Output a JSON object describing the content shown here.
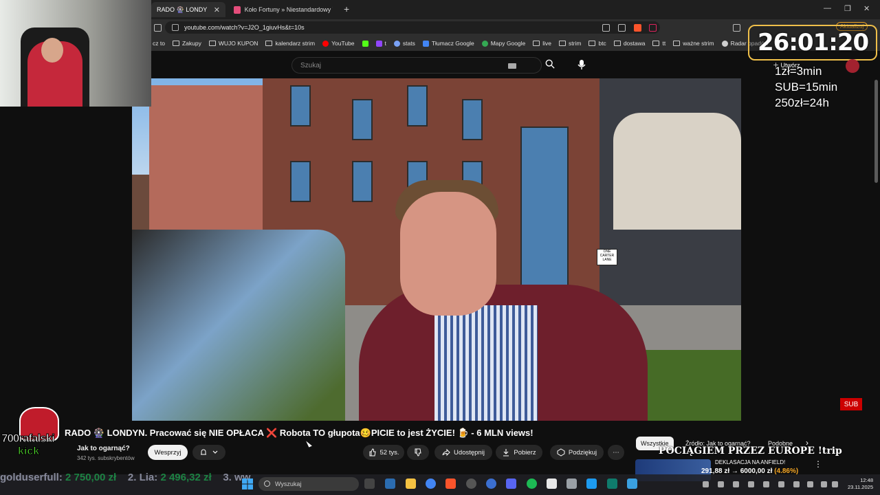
{
  "browser": {
    "tabs": [
      {
        "label": "RADO 🎡 LONDYN. Pracować",
        "active": true
      },
      {
        "label": "Koło Fortuny » Niestandardowy Wyb",
        "active": false
      }
    ],
    "url": "youtube.com/watch?v=J2O_1giuvHs&t=10s",
    "update_label": "Aktualizuj",
    "bookmarks": [
      "cz to",
      "Zakupy",
      "WUJO KUPON",
      "kalendarz strim",
      "YouTube",
      "t",
      "stats",
      "Tłumacz Google",
      "Mapy Google",
      "live",
      "strim",
      "btc",
      "dostawa",
      "tt",
      "ważne strim",
      "Radar opadów"
    ]
  },
  "youtube": {
    "search_placeholder": "Szukaj",
    "create_label": "Utwórz",
    "video_title": "RADO 🎡 LONDYN. Pracować się NIE OPŁACA ❌ Robota TO głupota🥴PICIE to jest ŻYCIE! 🍺 - 6 MLN views!",
    "channel_name": "Jak to ogarnąć?",
    "subscribers": "342 tys. subskrybentów",
    "support_label": "Wesprzyj",
    "like_count": "52 tys.",
    "share_label": "Udostępnij",
    "download_label": "Pobierz",
    "thanks_label": "Podziękuj",
    "chips": [
      "Wszystkie",
      "Źródło: Jak to ogarnąć?",
      "Podobne"
    ],
    "related": {
      "title": "POCIĄGIEM PRZEZ EUROPE !trip",
      "subtitle": "DEKLASACJA NA ANFIELD!",
      "price": "291,88 zł → 6000,00 zł",
      "percent": "(4.86%)"
    },
    "sign_text": "ONE CARTER LANE"
  },
  "stream": {
    "timer": "26:01:20",
    "rules": [
      "1zł=3min",
      "SUB=15min",
      "250zł=24h"
    ],
    "sub_badge": "SUB",
    "kick_name": "700rafalski",
    "kick_tag": "kick",
    "ticker": [
      {
        "name": "golduserfull:",
        "amount": "2 750,00 zł"
      },
      {
        "name": "2. Lia:",
        "amount": "2 496,32 zł"
      },
      {
        "name": "3. ww",
        "amount": ""
      }
    ]
  },
  "taskbar": {
    "search_placeholder": "Wyszukaj",
    "time": "12:48",
    "date": "23.11.2025"
  }
}
